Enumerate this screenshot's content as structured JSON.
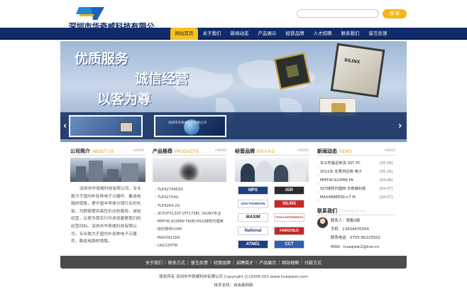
{
  "header": {
    "logo_text": "深圳市华奇威科技有限公司",
    "search_placeholder": "",
    "search_button": "搜 索"
  },
  "nav": {
    "items": [
      "网站首页",
      "关于我们",
      "新闻动态",
      "产品展示",
      "经营品牌",
      "人才招聘",
      "联系我们",
      "留言反馈"
    ],
    "active_index": 0
  },
  "banner": {
    "slogan_1": "优质服务",
    "slogan_2": "诚信经营",
    "slogan_3": "以客为尊",
    "chip_label": "XILINX",
    "arrow_left": "‹",
    "arrow_right": "›",
    "thumb_2_text": "深圳市华奇威科技有限公司"
  },
  "company": {
    "title": "公司简介",
    "title_en": "ABOUT US",
    "more": "+MORE",
    "text": "深圳市华奇威科技有限公司，专业致力于国内外各种电子元器件、集成电路的销售，是中国半导体分销行业的先驱。为顾客提供高性价比的服务，诚信经营，以客为尊实行共求双赢是我们的经营目标。深圳市华奇威科技有限公司，专业致力于国内外各种电子元器件、集成电路的销售。"
  },
  "products": {
    "title": "产品推荐",
    "title_en": "PRODUCTS",
    "more": "+MORE",
    "items": [
      "TLE42744D50",
      "TLE42754G",
      "TLE4264-2G",
      "XC5VFX130T-1FF1738C XILINX专业",
      "MMT4C923MW FAIRCHILD授权代理商",
      "快乐陪伴COMI",
      "MAX3421EA",
      "LM2325TM"
    ]
  },
  "brands": {
    "title": "经营品牌",
    "title_en": "BRAND",
    "more": "+MORE",
    "logos": [
      {
        "name": "MPS",
        "fg": "#ffffff",
        "bg": "#1d3f86"
      },
      {
        "name": "IGR",
        "fg": "#ffffff",
        "bg": "#2b2b2b"
      },
      {
        "name": "SGS-THOMSON",
        "fg": "#1f3f8a",
        "bg": "#ffffff"
      },
      {
        "name": "XILINX",
        "fg": "#ffffff",
        "bg": "#c62828"
      },
      {
        "name": "MAXIM",
        "fg": "#1a1a1a",
        "bg": "#ffffff"
      },
      {
        "name": "TEXAS INSTRUMENTS",
        "fg": "#c62828",
        "bg": "#ffffff"
      },
      {
        "name": "National",
        "fg": "#1f3f8a",
        "bg": "#ffffff"
      },
      {
        "name": "FAIRCHILD",
        "fg": "#ffffff",
        "bg": "#c62828"
      },
      {
        "name": "ATMEL",
        "fg": "#ffffff",
        "bg": "#1f3f8a"
      },
      {
        "name": "CCT",
        "fg": "#ffffff",
        "bg": "#2e5fb3"
      }
    ]
  },
  "news": {
    "title": "新闻动态",
    "title_en": "NEWS",
    "more": "+MORE",
    "items": [
      {
        "text": "本公司最近到货 SST PC",
        "date": "[05-29]"
      },
      {
        "text": "2011年 优秀供应商 电子",
        "date": "[05-29]"
      },
      {
        "text": "MMT4C923MW FA",
        "date": "[04-08]"
      },
      {
        "text": "SST授权代理商 华奇威科技",
        "date": "[04-07]"
      },
      {
        "text": "MAX488EESD+T M",
        "date": "[04-07]"
      }
    ]
  },
  "contact": {
    "title": "联系我们",
    "title_en": "CONTACT US",
    "items": [
      "联系人：销售0部",
      "手机：13434470354",
      "联系电话：0755-85225502",
      "MSN：huaqiwei2@live.cn"
    ]
  },
  "footer": {
    "links": [
      "关于我们",
      "联系方式",
      "留言反馈",
      "经营品牌",
      "招聘英才",
      "产品展示",
      "网站地图",
      "付款方式"
    ],
    "separator": "|",
    "copyright": "版权所有  深圳市华奇威科技有限公司  Copyright (C)2009-201  www.huaqiwei.com",
    "support": "技术支持：自由者网络"
  },
  "colors": {
    "nav_bg": "#0f2b6a",
    "accent": "#f6c223",
    "footer_bg": "#4a4b4d"
  }
}
